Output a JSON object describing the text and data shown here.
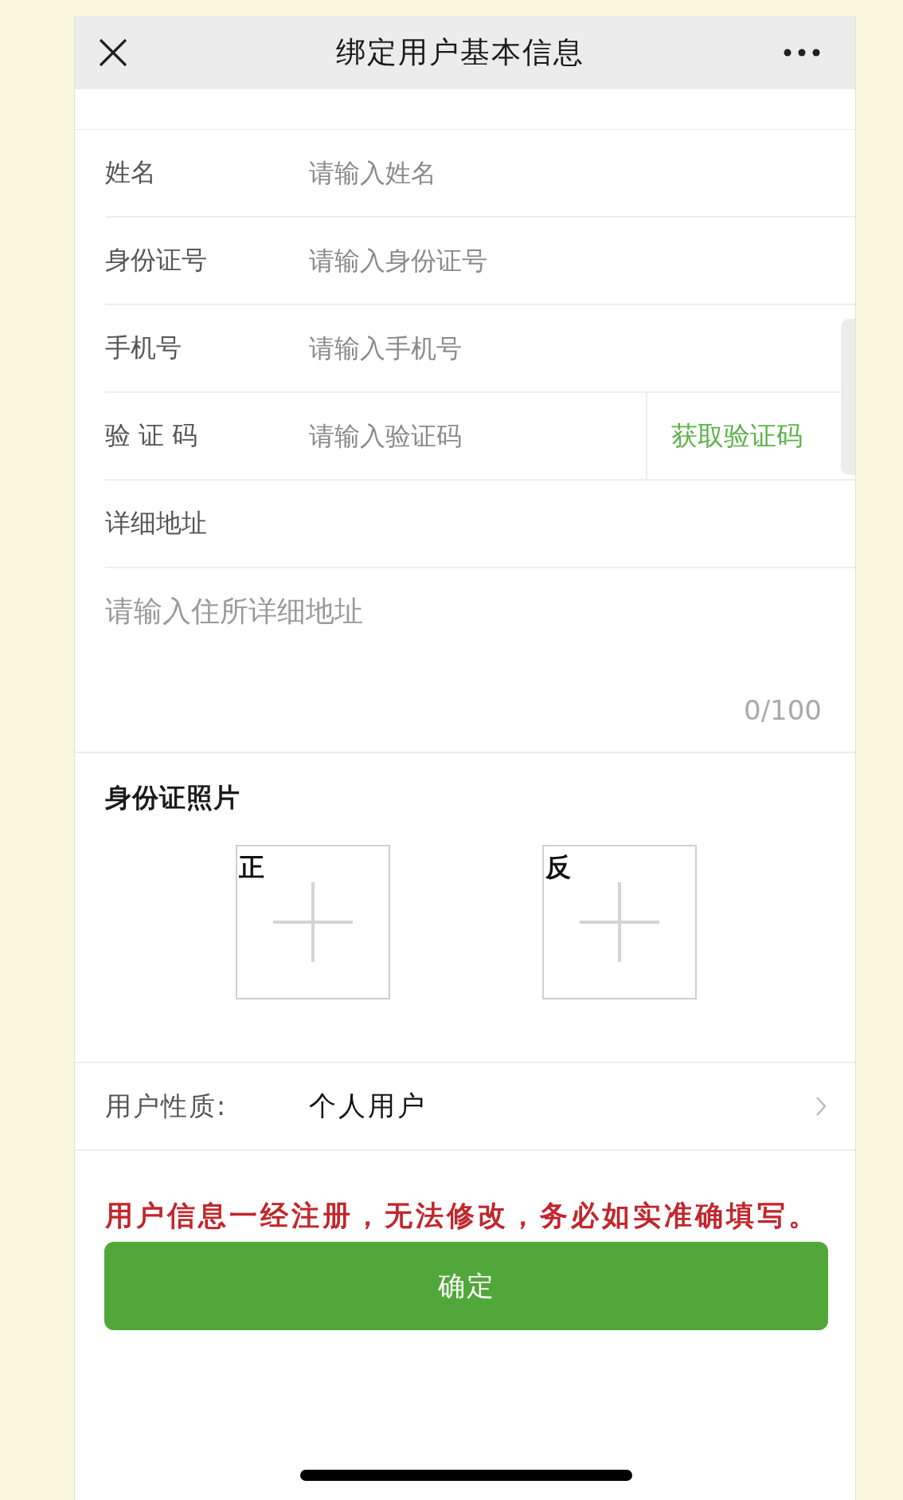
{
  "header": {
    "title": "绑定用户基本信息"
  },
  "fields": [
    {
      "kind": "text",
      "label": "姓名",
      "placeholder": "请输入姓名"
    },
    {
      "kind": "text",
      "label": "身份证号",
      "placeholder": "请输入身份证号"
    },
    {
      "kind": "text",
      "label": "手机号",
      "placeholder": "请输入手机号"
    },
    {
      "kind": "code",
      "label": "验 证 码",
      "placeholder": "请输入验证码",
      "action": "获取验证码"
    }
  ],
  "address": {
    "label": "详细地址",
    "placeholder": "请输入住所详细地址",
    "counter": "0/100"
  },
  "id_photos": {
    "title": "身份证照片",
    "slots": [
      {
        "label": "正"
      },
      {
        "label": "反"
      }
    ]
  },
  "user_type": {
    "label": "用户性质:",
    "value": "个人用户"
  },
  "notice": "用户信息一经注册，无法修改，务必如实准确填写。",
  "submit_button": "确定"
}
